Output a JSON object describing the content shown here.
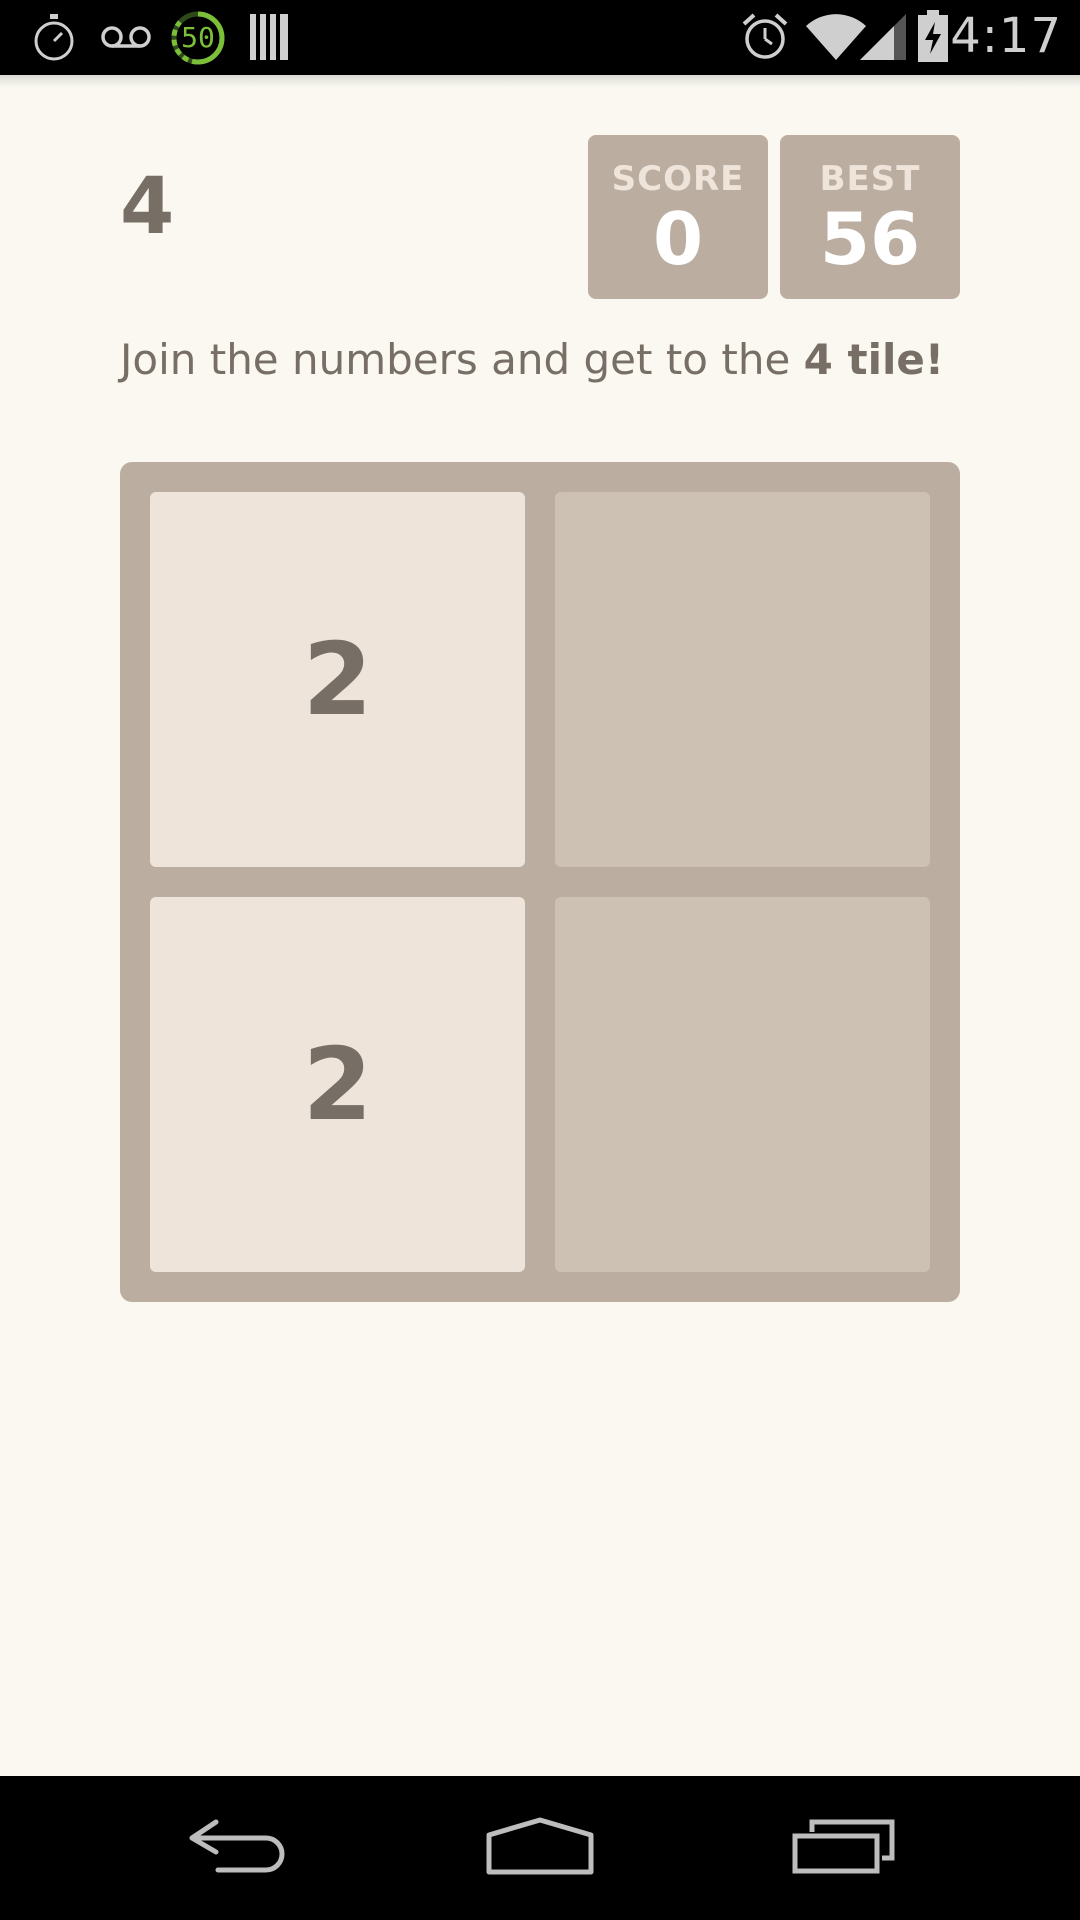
{
  "status_bar": {
    "time": "4:17",
    "data_saver_value": "50",
    "left_icons": [
      "stopwatch-icon",
      "voicemail-icon",
      "data-usage-icon",
      "barcode-icon"
    ],
    "right_icons": [
      "alarm-icon",
      "wifi-icon",
      "cell-signal-icon",
      "battery-charging-icon"
    ]
  },
  "header": {
    "title": "4",
    "score_label": "SCORE",
    "score_value": "0",
    "best_label": "BEST",
    "best_value": "56"
  },
  "intro": {
    "text": "Join the numbers and get to the ",
    "goal": "4 tile!"
  },
  "board": {
    "size": 2,
    "cells": [
      {
        "row": 0,
        "col": 0,
        "value": "2"
      },
      {
        "row": 0,
        "col": 1,
        "value": ""
      },
      {
        "row": 1,
        "col": 0,
        "value": "2"
      },
      {
        "row": 1,
        "col": 1,
        "value": ""
      }
    ]
  },
  "nav_bar": {
    "buttons": [
      "back-icon",
      "home-icon",
      "recents-icon"
    ]
  },
  "colors": {
    "background": "#faf8f1",
    "board": "#bbada0",
    "empty_cell": "#cdc1b4",
    "tile_2": "#eee4da",
    "text": "#776e65"
  }
}
